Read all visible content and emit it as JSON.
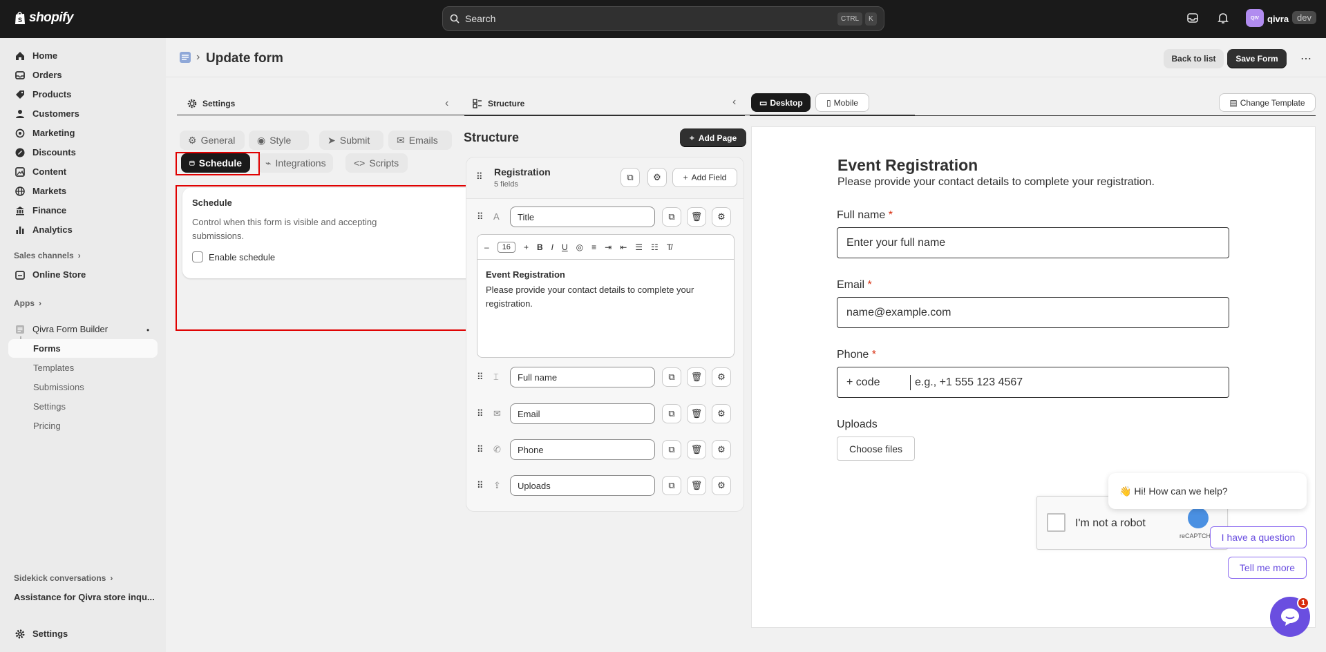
{
  "topbar": {
    "logo": "shopify",
    "search_placeholder": "Search",
    "kbd_ctrl": "CTRL",
    "kbd_k": "K",
    "avatar_initials": "QIV",
    "store_name": "qivra",
    "env_badge": "dev"
  },
  "sidebar": {
    "items": [
      {
        "label": "Home",
        "icon": "home-icon"
      },
      {
        "label": "Orders",
        "icon": "orders-icon"
      },
      {
        "label": "Products",
        "icon": "tag-icon"
      },
      {
        "label": "Customers",
        "icon": "person-icon"
      },
      {
        "label": "Marketing",
        "icon": "target-icon"
      },
      {
        "label": "Discounts",
        "icon": "discount-icon"
      },
      {
        "label": "Content",
        "icon": "content-icon"
      },
      {
        "label": "Markets",
        "icon": "globe-icon"
      },
      {
        "label": "Finance",
        "icon": "bank-icon"
      },
      {
        "label": "Analytics",
        "icon": "chart-icon"
      }
    ],
    "sales_channels": "Sales channels",
    "online_store": "Online Store",
    "apps": "Apps",
    "app_name": "Qivra Form Builder",
    "app_sub": [
      "Forms",
      "Templates",
      "Submissions",
      "Settings",
      "Pricing"
    ],
    "sidekick": "Sidekick conversations",
    "conversation": "Assistance for Qivra store inqu...",
    "settings": "Settings"
  },
  "header": {
    "title": "Update form",
    "back_to_list": "Back to list",
    "save_form": "Save Form"
  },
  "settings_panel": {
    "title": "Settings",
    "tabs": [
      "General",
      "Style",
      "Submit",
      "Emails",
      "Schedule",
      "Integrations",
      "Scripts"
    ],
    "active_tab": "Schedule",
    "card_title": "Schedule",
    "card_desc": "Control when this form is visible and accepting submissions.",
    "checkbox_label": "Enable schedule"
  },
  "structure_panel": {
    "title": "Structure",
    "heading": "Structure",
    "add_page": "Add Page",
    "page_name": "Registration",
    "field_count": "5 fields",
    "add_field": "Add Field",
    "fields": [
      "Title",
      "Full name",
      "Email",
      "Phone",
      "Uploads"
    ],
    "font_size": "16",
    "rte_title": "Event Registration",
    "rte_body": "Please provide your contact details to complete your registration."
  },
  "preview": {
    "desktop": "Desktop",
    "mobile": "Mobile",
    "change_template": "Change Template",
    "form_title": "Event Registration",
    "form_subtitle": "Please provide your contact details to complete your registration.",
    "fullname_label": "Full name",
    "fullname_placeholder": "Enter your full name",
    "email_label": "Email",
    "email_placeholder": "name@example.com",
    "phone_label": "Phone",
    "phone_code": "+ code",
    "phone_placeholder": "e.g., +1 555 123 4567",
    "required_mark": "*",
    "uploads_label": "Uploads",
    "choose_files": "Choose files",
    "captcha_label": "I'm not a robot",
    "captcha_brand": "reCAPTCHA"
  },
  "chat": {
    "greeting": "👋 Hi! How can we help?",
    "option_1": "I have a question",
    "option_2": "Tell me more",
    "badge": "1"
  }
}
